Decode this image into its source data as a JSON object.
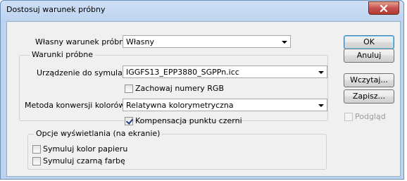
{
  "window": {
    "title": "Dostosuj warunek próbny"
  },
  "proof_condition": {
    "label": "Własny warunek próbny:",
    "value": "Własny"
  },
  "conditions_group": {
    "title": "Warunki próbne",
    "device_label": "Urządzenie do symulacji:",
    "device_value": "IGGFS13_EPP3880_SGPPn.icc",
    "preserve_rgb_label": "Zachowaj numery RGB",
    "preserve_rgb_checked": false,
    "intent_label": "Metoda konwersji kolorów:",
    "intent_value": "Relatywna kolorymetryczna",
    "bpc_label": "Kompensacja punktu czerni",
    "bpc_checked": true
  },
  "display_group": {
    "title": "Opcje wyświetlania (na ekranie)",
    "paper_color_label": "Symuluj kolor papieru",
    "paper_color_checked": false,
    "black_ink_label": "Symuluj czarną farbę",
    "black_ink_checked": false
  },
  "buttons": {
    "ok": "OK",
    "cancel": "Anuluj",
    "load": "Wczytaj...",
    "save": "Zapisz..."
  },
  "preview": {
    "label": "Podgląd",
    "checked": false,
    "enabled": false
  },
  "colors": {
    "accent": "#3c7fb1",
    "close": "#c75050"
  }
}
